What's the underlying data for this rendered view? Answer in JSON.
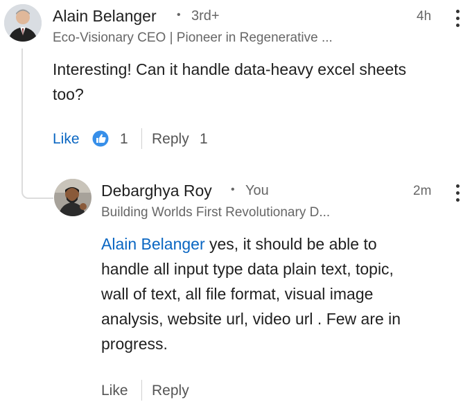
{
  "comment": {
    "author": "Alain Belanger",
    "degree": "3rd+",
    "headline": "Eco-Visionary CEO | Pioneer in Regenerative ...",
    "time": "4h",
    "text_lines": [
      "Interesting! Can it handle data-heavy excel sheets",
      "too?"
    ],
    "like_label": "Like",
    "reaction_count": "1",
    "reply_label": "Reply",
    "reply_count": "1"
  },
  "reply": {
    "author": "Debarghya Roy",
    "badge": "You",
    "headline": "Building Worlds First Revolutionary D...",
    "time": "2m",
    "mention": "Alain Belanger",
    "text_first": " yes, it should be able to",
    "text_lines": [
      "handle all input type data plain text, topic,",
      "wall of text, all file format, visual image",
      "analysis, website url, video url . Few are in",
      "progress."
    ],
    "like_label": "Like",
    "reply_label": "Reply"
  },
  "icons": {
    "more": "more-vertical-icon",
    "like_reaction": "thumbs-up-reaction-icon"
  },
  "colors": {
    "link_blue": "#0a66c2",
    "secondary_text": "#666666"
  }
}
